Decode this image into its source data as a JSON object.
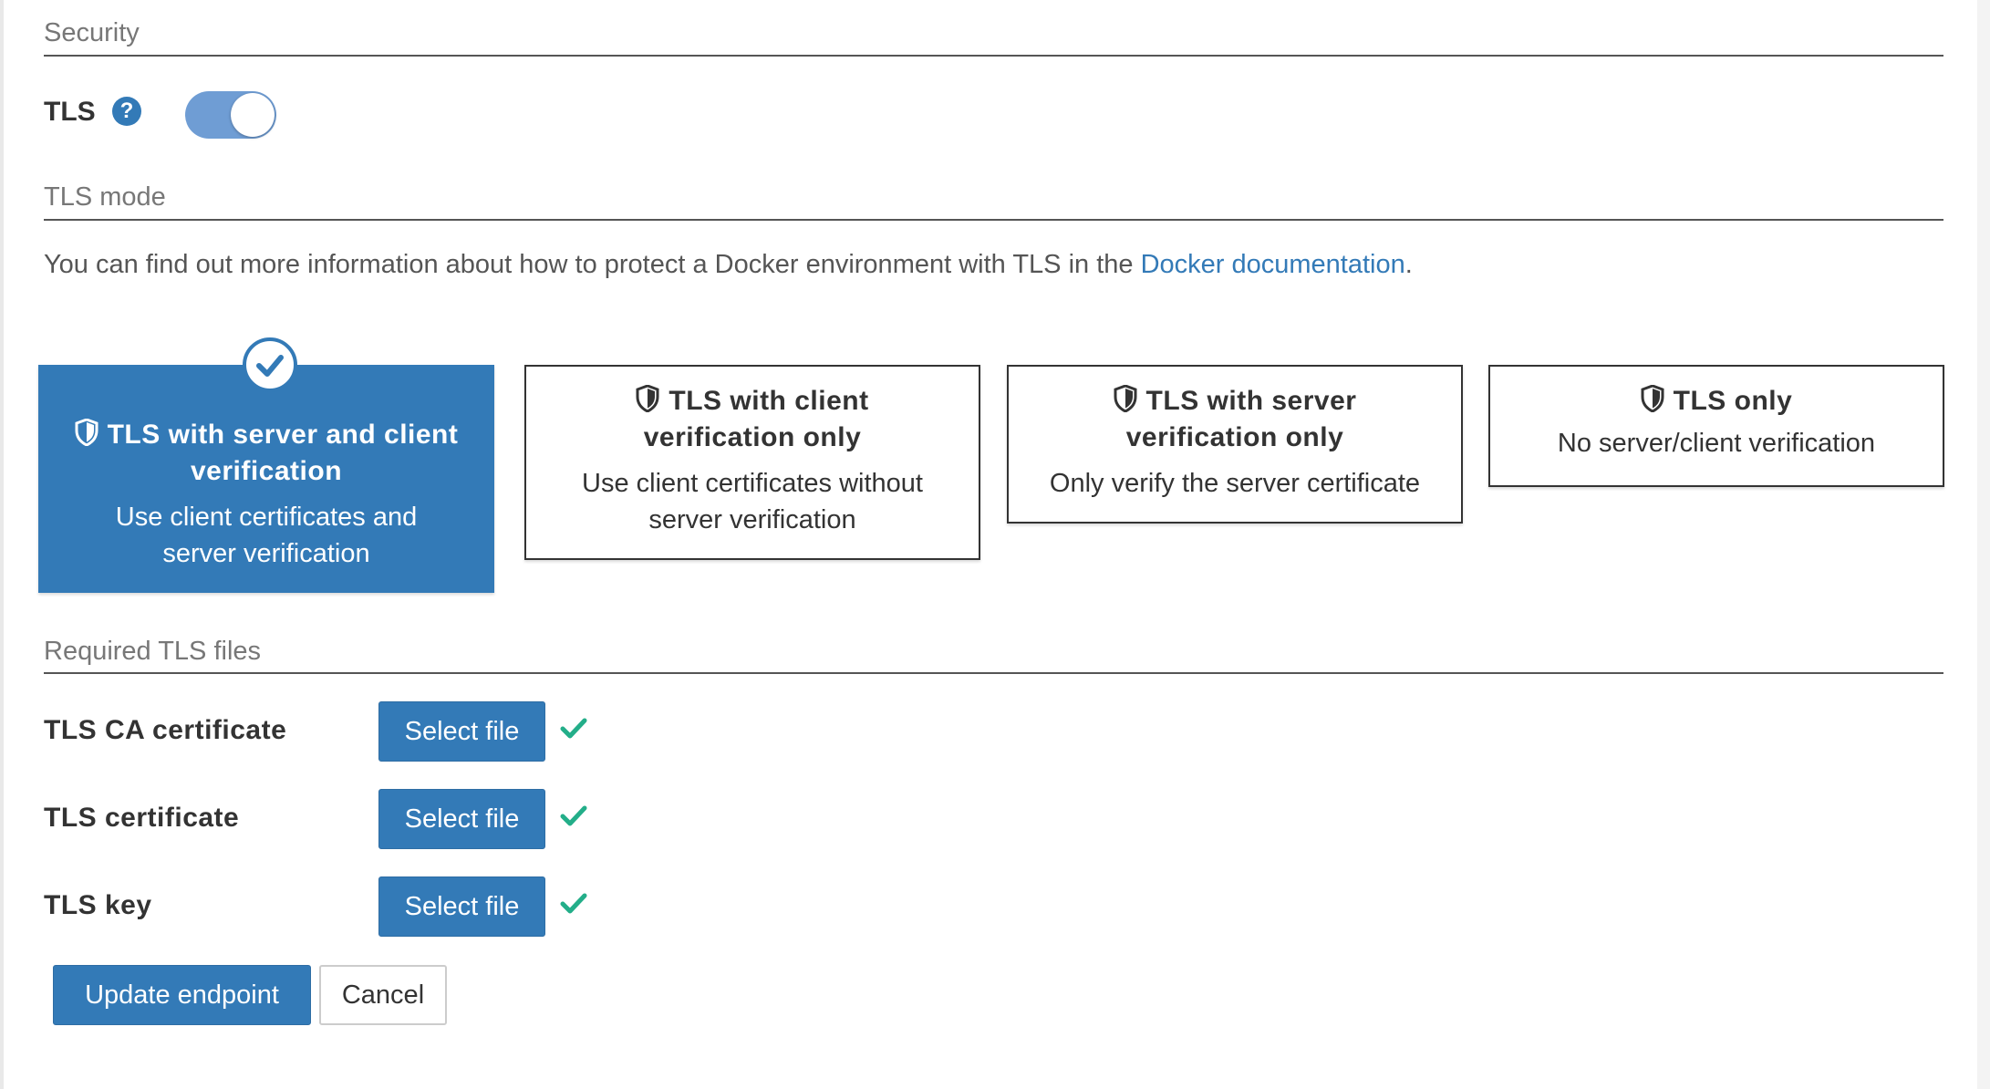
{
  "sections": {
    "security": "Security",
    "tls_mode": "TLS mode",
    "required_files": "Required TLS files"
  },
  "tls": {
    "label": "TLS",
    "help_icon": "question-circle-icon",
    "enabled": true
  },
  "info": {
    "text": "You can find out more information about how to protect a Docker environment with TLS in the ",
    "link": "Docker documentation",
    "after": "."
  },
  "modes": [
    {
      "title": "TLS with server and client verification",
      "description": "Use client certificates and server verification",
      "selected": true
    },
    {
      "title": "TLS with client verification only",
      "description": "Use client certificates without server verification",
      "selected": false
    },
    {
      "title": "TLS with server verification only",
      "description": "Only verify the server certificate",
      "selected": false
    },
    {
      "title": "TLS only",
      "description": "No server/client verification",
      "selected": false
    }
  ],
  "files": [
    {
      "label": "TLS CA certificate",
      "button": "Select file",
      "uploaded": true
    },
    {
      "label": "TLS certificate",
      "button": "Select file",
      "uploaded": true
    },
    {
      "label": "TLS key",
      "button": "Select file",
      "uploaded": true
    }
  ],
  "actions": {
    "update": "Update endpoint",
    "cancel": "Cancel"
  },
  "colors": {
    "primary": "#337ab7",
    "success": "#23ae89",
    "toggle_on": "#6f9dd4"
  }
}
